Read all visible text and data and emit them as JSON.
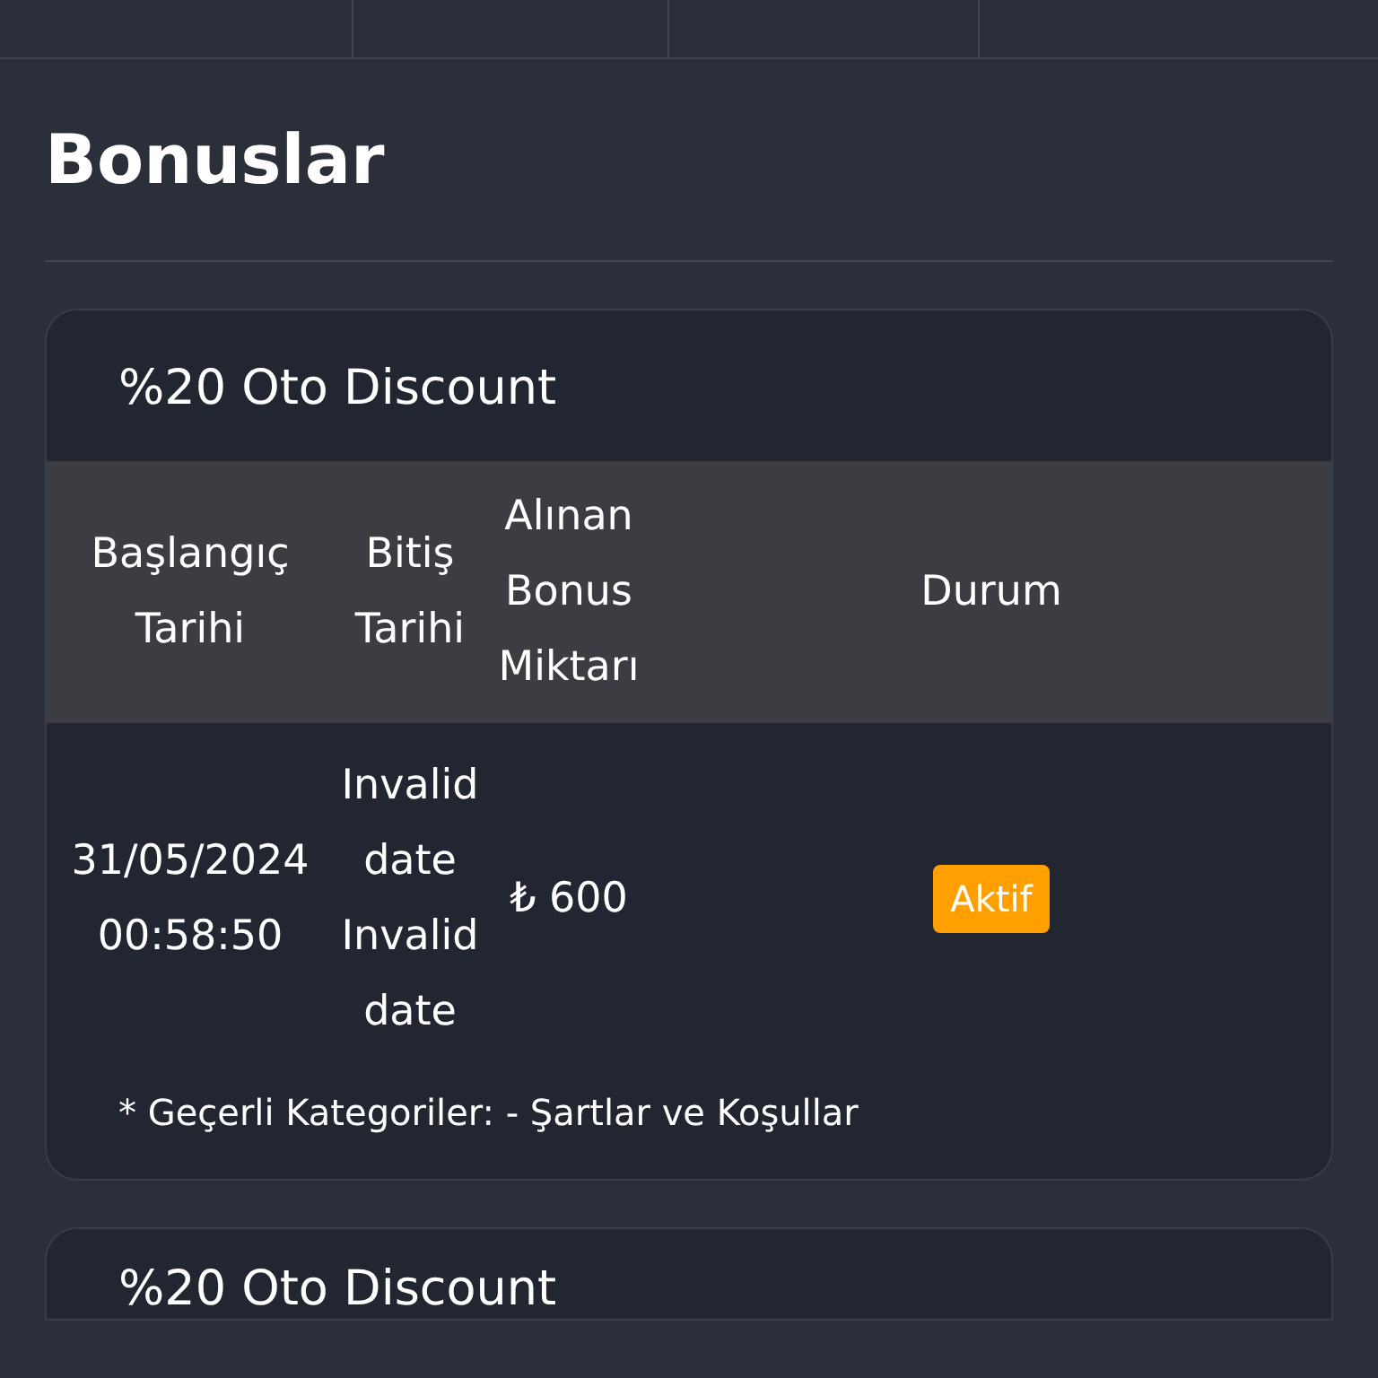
{
  "title": "Bonuslar",
  "bonuses": [
    {
      "name": "%20 Oto Discount",
      "columns": [
        "Başlangıç Tarihi",
        "Bitiş Tarihi",
        "Alınan Bonus Miktarı",
        "Durum"
      ],
      "rows": [
        {
          "start": "31/05/2024 00:58:50",
          "end": "Invalid date Invalid date",
          "amount": "₺ 600",
          "status": {
            "label": "Aktif",
            "kind": "active"
          }
        }
      ],
      "note": "* Geçerli Kategoriler: - Şartlar ve Koşullar"
    },
    {
      "name": "%20 Oto Discount"
    }
  ]
}
